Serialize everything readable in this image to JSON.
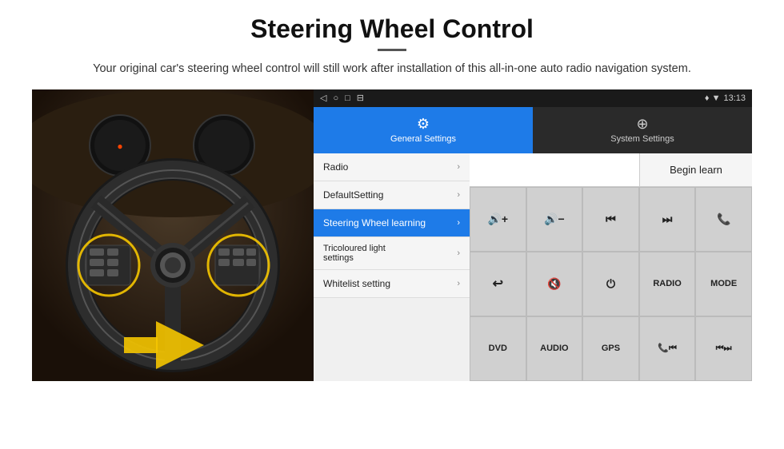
{
  "page": {
    "title": "Steering Wheel Control",
    "divider": true,
    "subtitle": "Your original car's steering wheel control will still work after installation of this all-in-one auto radio navigation system."
  },
  "statusBar": {
    "icons": [
      "◁",
      "○",
      "□",
      "⊟"
    ],
    "rightIcons": "♦ ▲",
    "time": "13:13"
  },
  "tabs": [
    {
      "id": "general",
      "label": "General Settings",
      "icon": "⚙",
      "active": true
    },
    {
      "id": "system",
      "label": "System Settings",
      "icon": "⊕",
      "active": false
    }
  ],
  "settingsItems": [
    {
      "label": "Radio",
      "active": false
    },
    {
      "label": "DefaultSetting",
      "active": false
    },
    {
      "label": "Steering Wheel learning",
      "active": true
    },
    {
      "label": "Tricoloured light settings",
      "active": false
    },
    {
      "label": "Whitelist setting",
      "active": false
    }
  ],
  "beginLearn": {
    "label": "Begin learn",
    "inputPlaceholder": ""
  },
  "controlButtons": {
    "row1": [
      {
        "label": "🔊+",
        "type": "icon"
      },
      {
        "label": "🔊−",
        "type": "icon"
      },
      {
        "label": "⏮",
        "type": "icon"
      },
      {
        "label": "⏭",
        "type": "icon"
      },
      {
        "label": "📞",
        "type": "icon"
      }
    ],
    "row2": [
      {
        "label": "↩",
        "type": "icon"
      },
      {
        "label": "🔊×",
        "type": "icon"
      },
      {
        "label": "⏻",
        "type": "icon"
      },
      {
        "label": "RADIO",
        "type": "text"
      },
      {
        "label": "MODE",
        "type": "text"
      }
    ],
    "row3": [
      {
        "label": "DVD",
        "type": "text"
      },
      {
        "label": "AUDIO",
        "type": "text"
      },
      {
        "label": "GPS",
        "type": "text"
      },
      {
        "label": "📞⏮",
        "type": "icon"
      },
      {
        "label": "⏮⏭",
        "type": "icon"
      }
    ]
  },
  "bottomRow": [
    {
      "label": "DVD"
    },
    {
      "label": "AUDIO"
    },
    {
      "label": "GPS"
    },
    {
      "label": "📞⏮"
    },
    {
      "label": "⏮⏭"
    }
  ],
  "whitelist": {
    "icon": "☰"
  }
}
